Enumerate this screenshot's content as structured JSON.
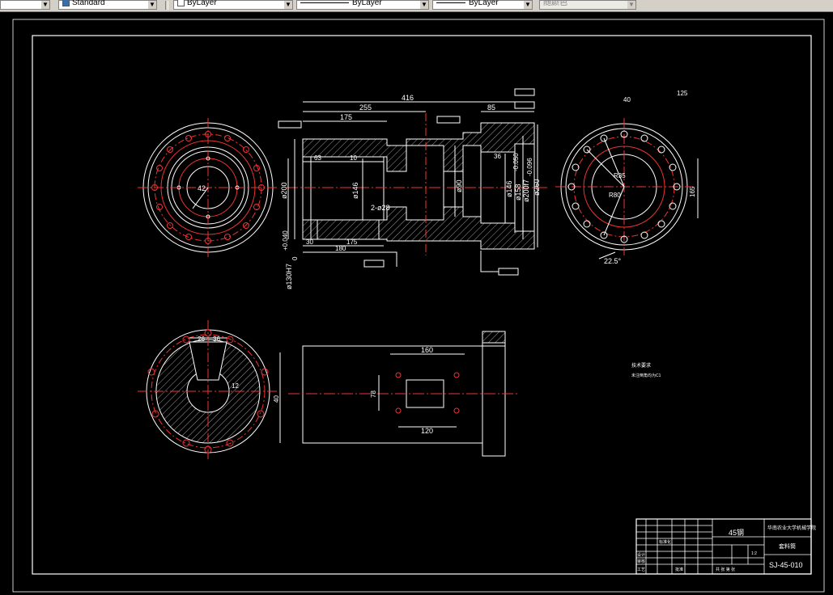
{
  "toolbar": {
    "textstyle": "Standard",
    "layer": "ByLayer",
    "linetype": "ByLayer",
    "lineweight": "ByLayer",
    "color": "随颜色"
  },
  "dims": {
    "d416": "416",
    "d255": "255",
    "d175": "175",
    "d85": "85",
    "d36": "36",
    "d63": "63",
    "d10": "10",
    "d146": "ø146",
    "d200": "ø200",
    "d130": "ø130H7",
    "d130tol": "+0.040",
    "d130tol2": "0",
    "d30": "30",
    "d180": "180",
    "d175b": "175",
    "hole2": "2-ø28",
    "d90": "ø90",
    "d146b": "ø146",
    "d158": "ø158",
    "d200f": "ø200f7",
    "d200tol": "-0.050",
    "d200tol2": "-0.096",
    "d260": "ø260",
    "d22_5": "22.5°",
    "d42": "42",
    "d165": "165",
    "d40": "40",
    "d12": "12",
    "d26": "26",
    "d36b": "36",
    "d160": "160",
    "d78": "78",
    "d120": "120",
    "r20": "R20",
    "r35": "R35",
    "r80": "R80",
    "sym40": "40",
    "sym125": "125"
  },
  "notes": {
    "tech_title": "技术要求",
    "tech_line1": "未注倒角均为C1"
  },
  "title_block": {
    "material": "45钢",
    "school": "华南农业大学机械学院",
    "part_name": "套料筒",
    "drawing_no": "SJ-45-010",
    "scale": "1:2",
    "designer": "设计",
    "checker": "审核",
    "process": "工艺",
    "std": "标准化",
    "approve": "批准",
    "sheet": "共 张 第 张"
  }
}
